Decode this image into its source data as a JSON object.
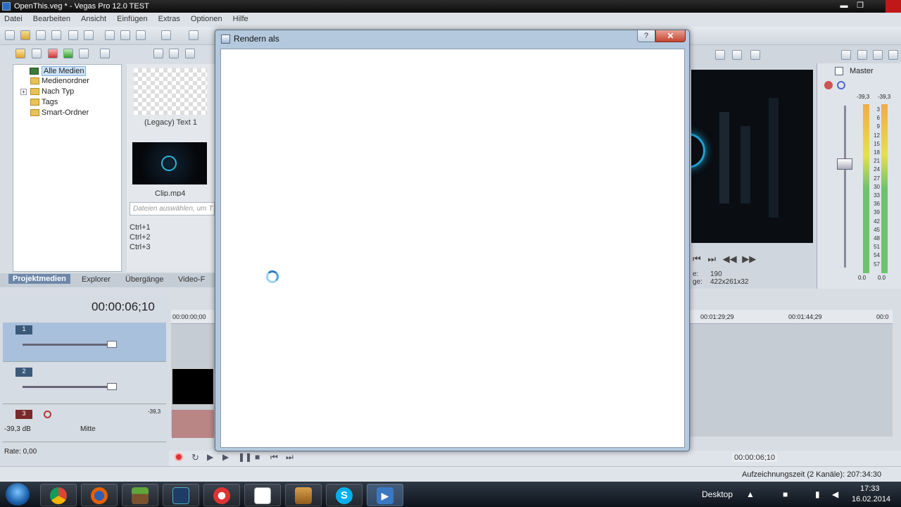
{
  "window": {
    "title": "OpenThis.veg * - Vegas Pro 12.0 TEST",
    "minimize": "▬",
    "restore": "❐"
  },
  "menu": [
    "Datei",
    "Bearbeiten",
    "Ansicht",
    "Einfügen",
    "Extras",
    "Optionen",
    "Hilfe"
  ],
  "explorer": {
    "tree": {
      "root": "Alle Medien",
      "items": [
        "Medienordner",
        "Nach Typ",
        "Tags",
        "Smart-Ordner"
      ],
      "expander": "+"
    },
    "media": [
      {
        "label": "(Legacy) Text 1"
      },
      {
        "label": "Clip.mp4"
      }
    ],
    "search_placeholder": "Dateien auswählen, um T",
    "shortcuts": [
      "Ctrl+1",
      "Ctrl+2",
      "Ctrl+3"
    ],
    "tabs": [
      "Projektmedien",
      "Explorer",
      "Übergänge",
      "Video-F"
    ]
  },
  "timeline": {
    "timecode": "00:00:06;10",
    "ruler_start": "00:00:00;00",
    "ruler_marks": [
      "00:01:29;29",
      "00:01:44;29",
      "00:0"
    ],
    "tracks": [
      {
        "number": "1",
        "type": "video"
      },
      {
        "number": "2",
        "type": "video"
      },
      {
        "number": "3",
        "type": "audio",
        "volume": "-39,3 dB",
        "pan": "Mitte",
        "level": "-39,3"
      }
    ],
    "rate": "Rate: 0,00",
    "end_timecode": "00:00:06;10"
  },
  "preview": {
    "frame_label": "e:",
    "frame_value": "190",
    "display_label": "ge:",
    "display_value": "422x261x32"
  },
  "mixer": {
    "title": "Master",
    "levels_top": [
      "-39,3",
      "-39,3"
    ],
    "scale": [
      "3",
      "6",
      "9",
      "12",
      "15",
      "18",
      "21",
      "24",
      "27",
      "30",
      "33",
      "36",
      "39",
      "42",
      "45",
      "48",
      "51",
      "54",
      "57"
    ],
    "peaks": [
      "0.0",
      "0.0"
    ]
  },
  "status": {
    "record_time": "Aufzeichnungszeit (2 Kanäle): 207:34:30"
  },
  "dialog": {
    "title": "Rendern als",
    "help": "?",
    "close": "✕"
  },
  "taskbar": {
    "apps": [
      "chrome",
      "firefox",
      "minecraft",
      "vegas",
      "ccleaner",
      "notepad",
      "winrar",
      "skype",
      "media-player"
    ],
    "desktop_label": "Desktop",
    "time": "17:33",
    "date": "16.02.2014"
  },
  "colors": {
    "dialog_frame": "#b5c9de",
    "close_button": "#c44631",
    "taskbar": "#0e141b",
    "active_tab": "#6d87a8"
  }
}
